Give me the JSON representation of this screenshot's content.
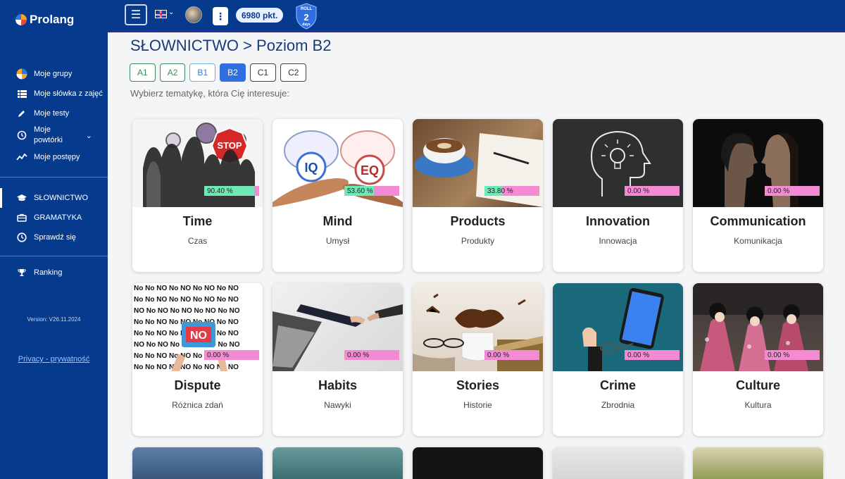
{
  "app": {
    "logo_text": "Prolang"
  },
  "sidebar": {
    "items": [
      {
        "label": "Moje grupy",
        "icon": "groups-icon"
      },
      {
        "label": "Moje słówka z zajęć",
        "icon": "list-icon"
      },
      {
        "label": "Moje testy",
        "icon": "pencil-icon"
      },
      {
        "label": "Moje powtórki",
        "icon": "history-icon"
      },
      {
        "label": "Moje postępy",
        "icon": "chart-line-icon"
      }
    ],
    "sections": [
      {
        "label": "SŁOWNICTWO",
        "icon": "graduation-cap-icon",
        "active": true
      },
      {
        "label": "GRAMATYKA",
        "icon": "briefcase-icon"
      },
      {
        "label": "Sprawdź się",
        "icon": "clock-icon"
      }
    ],
    "ranking": {
      "label": "Ranking",
      "icon": "trophy-icon"
    },
    "version": "Version: V26.11.2024",
    "privacy": "Privacy - prywatność"
  },
  "topbar": {
    "points": "6980 pkt.",
    "roll_label": "ROLL",
    "roll_value": "2",
    "roll_unit": "days"
  },
  "main": {
    "title": "SŁOWNICTWO > Poziom B2",
    "levels": [
      "A1",
      "A2",
      "B1",
      "B2",
      "C1",
      "C2"
    ],
    "active_level": "B2",
    "subtitle": "Wybierz tematykę, która Cię interesuje:"
  },
  "topics": [
    {
      "name": "Time",
      "pl": "Czas",
      "progress": "90.40 %",
      "percent": 90.4,
      "image": "people-clocks-stop-sign"
    },
    {
      "name": "Mind",
      "pl": "Umysł",
      "progress": "53.60 %",
      "percent": 53.6,
      "image": "iq-eq-brains"
    },
    {
      "name": "Products",
      "pl": "Produkty",
      "progress": "33.80 %",
      "percent": 33.8,
      "image": "coffee-notebook"
    },
    {
      "name": "Innovation",
      "pl": "Innowacja",
      "progress": "0.00 %",
      "percent": 0,
      "image": "chalkboard-head-bulb"
    },
    {
      "name": "Communication",
      "pl": "Komunikacja",
      "progress": "0.00 %",
      "percent": 0,
      "image": "two-faces-dark"
    },
    {
      "name": "Dispute",
      "pl": "Różnica zdań",
      "progress": "0.00 %",
      "percent": 0,
      "image": "no-words-collage"
    },
    {
      "name": "Habits",
      "pl": "Nawyki",
      "progress": "0.00 %",
      "percent": 0,
      "image": "laptop-hands"
    },
    {
      "name": "Stories",
      "pl": "Historie",
      "progress": "0.00 %",
      "percent": 0,
      "image": "coffee-splash-books"
    },
    {
      "name": "Crime",
      "pl": "Zbrodnia",
      "progress": "0.00 %",
      "percent": 0,
      "image": "handcuffed-tablet"
    },
    {
      "name": "Culture",
      "pl": "Kultura",
      "progress": "0.00 %",
      "percent": 0,
      "image": "kimono-women"
    }
  ]
}
